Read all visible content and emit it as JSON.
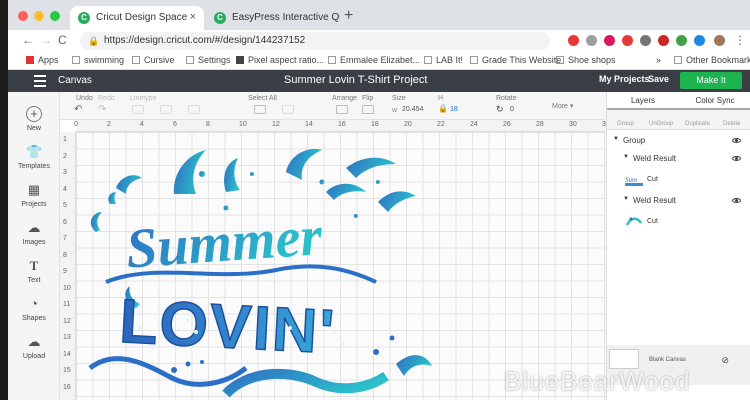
{
  "browser": {
    "tabs": [
      {
        "title": "Cricut Design Space",
        "active": true
      },
      {
        "title": "EasyPress Interactive Quick Re",
        "active": false
      }
    ],
    "new_tab": "+",
    "back": "←",
    "forward": "→",
    "reload": "C",
    "url": "https://design.cricut.com/#/design/144237152",
    "bookmarks": [
      "Apps",
      "swimming",
      "Cursive",
      "Settings",
      "Pixel aspect ratio...",
      "Emmalee Elizabet...",
      "LAB It!",
      "Grade This Website",
      "Shoe shops"
    ],
    "other_bookmarks": "Other Bookmarks",
    "more": "»"
  },
  "header": {
    "canvas_label": "Canvas",
    "project_title": "Summer Lovin T-Shirt Project",
    "my_projects": "My Projects",
    "save": "Save",
    "make_it": "Make It"
  },
  "toolbar": {
    "undo": "Undo",
    "redo": "Redo",
    "linetype": "Linetype",
    "select_all": "Select All",
    "arrange": "Arrange",
    "flip": "Flip",
    "size": "Size",
    "size_w_label": "w",
    "size_w": "20.454",
    "size_h_label": "H",
    "size_h": "18",
    "rotate": "Rotate",
    "rotate_value": "0",
    "more": "More ▾"
  },
  "left_panel": [
    "New",
    "Templates",
    "Projects",
    "Images",
    "Text",
    "Shapes",
    "Upload"
  ],
  "rulers": {
    "horizontal": [
      "0",
      "2",
      "4",
      "6",
      "8",
      "10",
      "12",
      "14",
      "16",
      "18",
      "20",
      "22",
      "24",
      "26",
      "28",
      "30",
      "32"
    ],
    "vertical": [
      "1",
      "2",
      "3",
      "4",
      "5",
      "6",
      "7",
      "8",
      "9",
      "10",
      "11",
      "12",
      "13",
      "14",
      "15",
      "16"
    ]
  },
  "layers_panel": {
    "tabs": [
      "Layers",
      "Color Sync"
    ],
    "actions": [
      "Group",
      "UnGroup",
      "Duplicate",
      "Delete"
    ],
    "group_label": "Group",
    "items": [
      {
        "name": "Weld Result",
        "operation": "Cut"
      },
      {
        "name": "Weld Result",
        "operation": "Cut"
      }
    ],
    "blank_canvas": "Blank Canvas"
  },
  "artwork": {
    "line1": "Summer",
    "line2": "LOVIN'"
  },
  "colors": {
    "header_bg": "#3a3f45",
    "make_it": "#1db34f",
    "art_dark": "#2f6fc4",
    "art_light": "#2bc1c9"
  },
  "icons": [
    "menu-icon",
    "plus-icon",
    "shirt-icon",
    "projects-icon",
    "images-icon",
    "text-icon",
    "shapes-icon",
    "upload-icon",
    "eye-icon",
    "lock-icon"
  ],
  "watermark": "BlueBearWood"
}
